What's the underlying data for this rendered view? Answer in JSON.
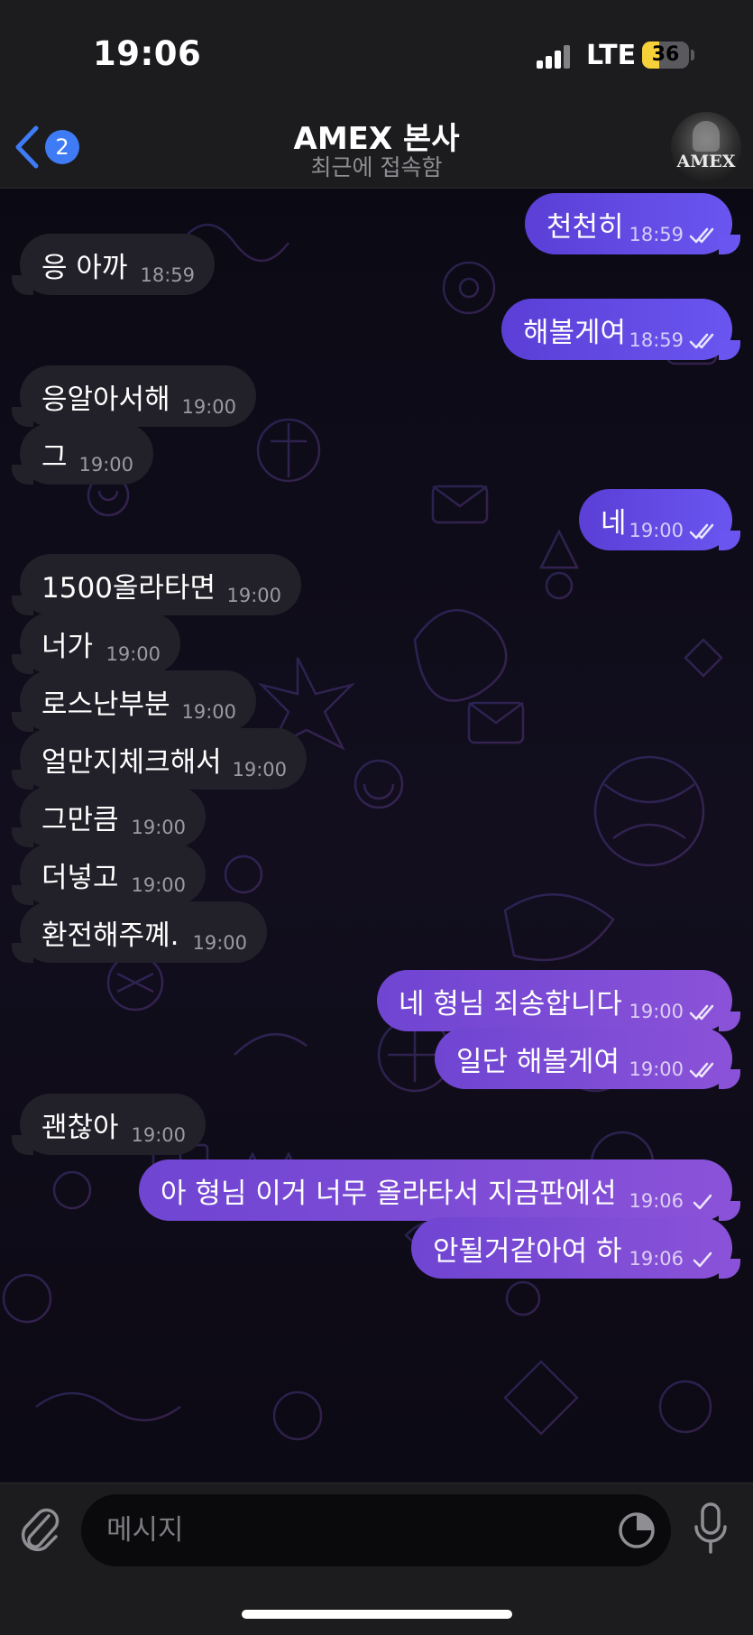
{
  "status_bar": {
    "time": "19:06",
    "network": "LTE",
    "battery_level": "36",
    "battery_fraction": 0.36
  },
  "nav": {
    "back_badge": "2",
    "title": "AMEX 본사",
    "status": "최근에 접속함",
    "avatar_text": "AMEX"
  },
  "messages": [
    {
      "dir": "out",
      "text": "천천히",
      "time": "18:59",
      "read": true
    },
    {
      "dir": "in",
      "text": "응 아까",
      "time": "18:59"
    },
    {
      "dir": "out",
      "text": "해볼게여",
      "time": "18:59",
      "read": true
    },
    {
      "dir": "in",
      "text": "응알아서해",
      "time": "19:00"
    },
    {
      "dir": "in",
      "text": "그",
      "time": "19:00"
    },
    {
      "dir": "out",
      "text": "네",
      "time": "19:00",
      "read": true
    },
    {
      "dir": "in",
      "text": "1500올라타면",
      "time": "19:00"
    },
    {
      "dir": "in",
      "text": "너가",
      "time": "19:00"
    },
    {
      "dir": "in",
      "text": "로스난부분",
      "time": "19:00"
    },
    {
      "dir": "in",
      "text": "얼만지체크해서",
      "time": "19:00"
    },
    {
      "dir": "in",
      "text": "그만큼",
      "time": "19:00"
    },
    {
      "dir": "in",
      "text": "더넣고",
      "time": "19:00"
    },
    {
      "dir": "in",
      "text": "환전해주꼐.",
      "time": "19:00"
    },
    {
      "dir": "out",
      "text": "네 형님 죄송합니다",
      "time": "19:00",
      "read": true
    },
    {
      "dir": "out",
      "text": "일단 해볼게여",
      "time": "19:00",
      "read": true
    },
    {
      "dir": "in",
      "text": "괜찮아",
      "time": "19:00"
    },
    {
      "dir": "out",
      "text": "아 형님 이거 너무 올라타서 지금판에선",
      "time": "19:06",
      "read": false
    },
    {
      "dir": "out",
      "text": "안될거같아여 하",
      "time": "19:06",
      "read": false
    }
  ],
  "input": {
    "placeholder": "메시지"
  },
  "icons": {
    "back": "chevron-left-icon",
    "attach": "paperclip-icon",
    "sticker": "sticker-icon",
    "mic": "microphone-icon",
    "read": "double-check-icon",
    "sent": "single-check-icon"
  },
  "colors": {
    "outgoing_blue": "#5b5ff0",
    "outgoing_purple": "#7c4bd6",
    "incoming": "#222028",
    "accent": "#3e7bf5"
  }
}
